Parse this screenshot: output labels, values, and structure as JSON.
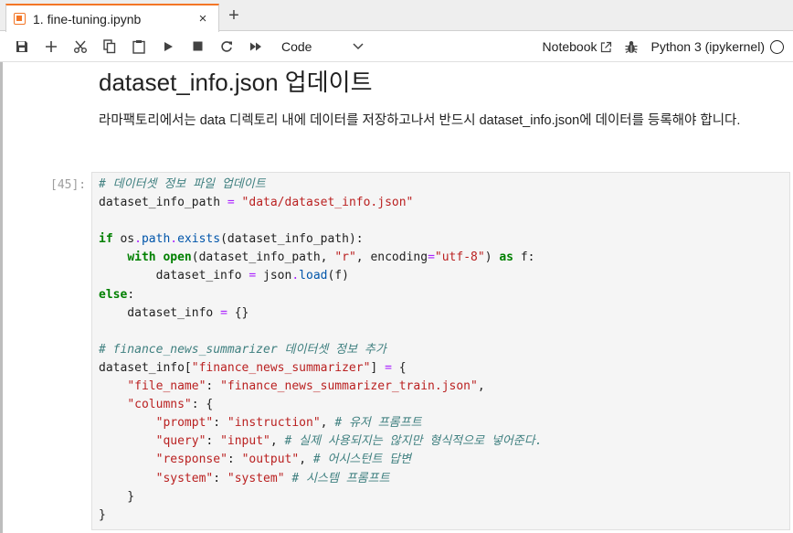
{
  "tab": {
    "title": "1. fine-tuning.ipynb",
    "close": "×",
    "add": "+"
  },
  "toolbar": {
    "cell_type": "Code",
    "notebook_label": "Notebook",
    "kernel_name": "Python 3 (ipykernel)"
  },
  "markdown": {
    "heading": "dataset_info.json 업데이트",
    "paragraph": "라마팩토리에서는 data 디렉토리 내에 데이터를 저장하고나서 반드시 dataset_info.json에 데이터를 등록해야 합니다."
  },
  "code_cell": {
    "prompt": "[45]:",
    "lines": [
      [
        {
          "t": "# 데이터셋 정보 파일 업데이트",
          "c": "cm"
        }
      ],
      [
        {
          "t": "dataset_info_path "
        },
        {
          "t": "=",
          "c": "op"
        },
        {
          "t": " "
        },
        {
          "t": "\"data/dataset_info.json\"",
          "c": "str"
        }
      ],
      [],
      [
        {
          "t": "if",
          "c": "kw"
        },
        {
          "t": " os"
        },
        {
          "t": ".",
          "c": "op"
        },
        {
          "t": "path",
          "c": "fn"
        },
        {
          "t": ".",
          "c": "op"
        },
        {
          "t": "exists",
          "c": "fn"
        },
        {
          "t": "(dataset_info_path):"
        }
      ],
      [
        {
          "t": "    "
        },
        {
          "t": "with",
          "c": "kw"
        },
        {
          "t": " "
        },
        {
          "t": "open",
          "c": "kw"
        },
        {
          "t": "(dataset_info_path, "
        },
        {
          "t": "\"r\"",
          "c": "str"
        },
        {
          "t": ", encoding"
        },
        {
          "t": "=",
          "c": "op"
        },
        {
          "t": "\"utf-8\"",
          "c": "str"
        },
        {
          "t": ") "
        },
        {
          "t": "as",
          "c": "kw"
        },
        {
          "t": " f:"
        }
      ],
      [
        {
          "t": "        dataset_info "
        },
        {
          "t": "=",
          "c": "op"
        },
        {
          "t": " json"
        },
        {
          "t": ".",
          "c": "op"
        },
        {
          "t": "load",
          "c": "fn"
        },
        {
          "t": "(f)"
        }
      ],
      [
        {
          "t": "else",
          "c": "kw"
        },
        {
          "t": ":"
        }
      ],
      [
        {
          "t": "    dataset_info "
        },
        {
          "t": "=",
          "c": "op"
        },
        {
          "t": " {}"
        }
      ],
      [],
      [
        {
          "t": "# finance_news_summarizer 데이터셋 정보 추가",
          "c": "cm"
        }
      ],
      [
        {
          "t": "dataset_info["
        },
        {
          "t": "\"finance_news_summarizer\"",
          "c": "str"
        },
        {
          "t": "] "
        },
        {
          "t": "=",
          "c": "op"
        },
        {
          "t": " {"
        }
      ],
      [
        {
          "t": "    "
        },
        {
          "t": "\"file_name\"",
          "c": "str"
        },
        {
          "t": ": "
        },
        {
          "t": "\"finance_news_summarizer_train.json\"",
          "c": "str"
        },
        {
          "t": ","
        }
      ],
      [
        {
          "t": "    "
        },
        {
          "t": "\"columns\"",
          "c": "str"
        },
        {
          "t": ": {"
        }
      ],
      [
        {
          "t": "        "
        },
        {
          "t": "\"prompt\"",
          "c": "str"
        },
        {
          "t": ": "
        },
        {
          "t": "\"instruction\"",
          "c": "str"
        },
        {
          "t": ", "
        },
        {
          "t": "# 유저 프롬프트",
          "c": "cm"
        }
      ],
      [
        {
          "t": "        "
        },
        {
          "t": "\"query\"",
          "c": "str"
        },
        {
          "t": ": "
        },
        {
          "t": "\"input\"",
          "c": "str"
        },
        {
          "t": ", "
        },
        {
          "t": "# 실제 사용되지는 않지만 형식적으로 넣어준다.",
          "c": "cm"
        }
      ],
      [
        {
          "t": "        "
        },
        {
          "t": "\"response\"",
          "c": "str"
        },
        {
          "t": ": "
        },
        {
          "t": "\"output\"",
          "c": "str"
        },
        {
          "t": ", "
        },
        {
          "t": "# 어시스턴트 답변",
          "c": "cm"
        }
      ],
      [
        {
          "t": "        "
        },
        {
          "t": "\"system\"",
          "c": "str"
        },
        {
          "t": ": "
        },
        {
          "t": "\"system\"",
          "c": "str"
        },
        {
          "t": " "
        },
        {
          "t": "# 시스템 프롬프트",
          "c": "cm"
        }
      ],
      [
        {
          "t": "    }"
        }
      ],
      [
        {
          "t": "}"
        }
      ]
    ]
  },
  "icons": [
    "notebook-icon",
    "save-icon",
    "add-cell-icon",
    "cut-icon",
    "copy-icon",
    "paste-icon",
    "run-icon",
    "stop-icon",
    "restart-icon",
    "run-all-icon",
    "chevron-down-icon",
    "external-link-icon",
    "bug-icon",
    "kernel-status-icon"
  ],
  "colors": {
    "accent": "#f37626",
    "comment": "#408080",
    "keyword": "#008000",
    "string": "#ba2121",
    "operator": "#aa22ff"
  }
}
